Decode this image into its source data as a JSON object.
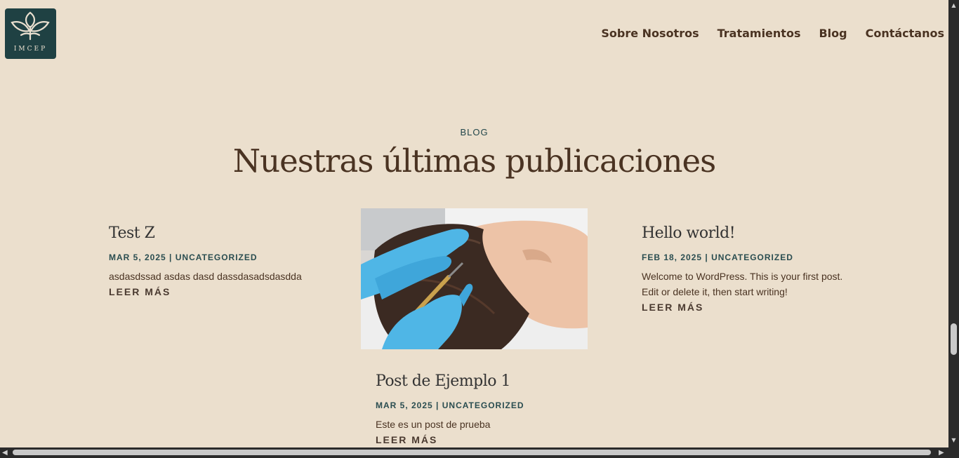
{
  "brand": {
    "logo_text": "IMCEP",
    "logo_icon": "leaf-plant-icon"
  },
  "nav": [
    "Sobre Nosotros",
    "Tratamientos",
    "Blog",
    "Contáctanos"
  ],
  "section": {
    "kicker": "BLOG",
    "heading": "Nuestras últimas publicaciones"
  },
  "posts": [
    {
      "title": "Test Z",
      "date": "MAR 5, 2025",
      "category": "UNCATEGORIZED",
      "excerpt": "asdasdssad asdas dasd dassdasadsdasdda",
      "more": "LEER MÁS"
    },
    {
      "title": "Hello world!",
      "date": "FEB 18, 2025",
      "category": "UNCATEGORIZED",
      "excerpt": "Welcome to WordPress. This is your first post. Edit or delete it, then start writing!",
      "more": "LEER MÁS"
    },
    {
      "title": "Post de Ejemplo 1",
      "date": "MAR 5, 2025",
      "category": "UNCATEGORIZED",
      "excerpt": "Este es un post de prueba",
      "more": "LEER MÁS"
    }
  ],
  "meta_separator": "|",
  "colors": {
    "background": "#ebdfcd",
    "brand_dark": "#1f4143",
    "text_brown": "#4a3322",
    "meta_teal": "#2a4d50"
  }
}
